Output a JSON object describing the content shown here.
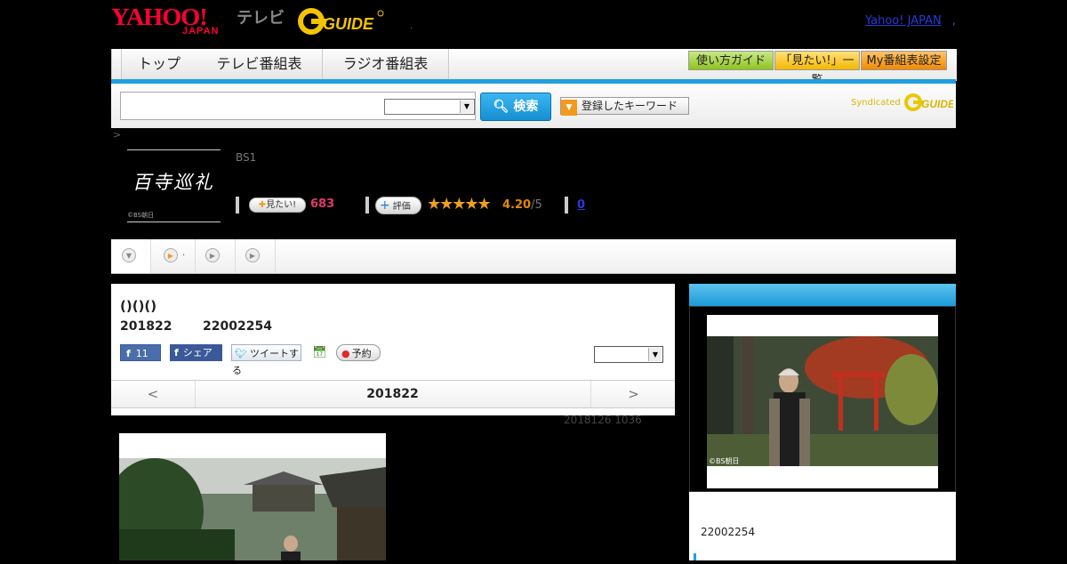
{
  "header": {
    "yahoo_logo": "YAHOO!",
    "yahoo_logo_sub": "JAPAN",
    "tv_label": "テレビ",
    "gguide_logo": "GUIDE",
    "yahoo_japan_link": "Yahoo! JAPAN",
    "dot": ".",
    "dot2": ","
  },
  "nav": {
    "tabs": [
      {
        "label": "トップ"
      },
      {
        "label": "テレビ番組表"
      },
      {
        "label": "ラジオ番組表"
      }
    ],
    "right_buttons": [
      {
        "label": "使い方ガイド",
        "color": "#8fc31f"
      },
      {
        "label": "「見たい!」一覧",
        "color": "#f5b800"
      },
      {
        "label": "My番組表設定",
        "color": "#f08a00"
      }
    ]
  },
  "search": {
    "input_value": "",
    "search_button": "検索",
    "keyword_button": "登録したキーワード",
    "syndicated": "Syndicated"
  },
  "crumb": ">",
  "program": {
    "thumb_title": "百寺巡礼",
    "thumb_copyright": "©BS朝日",
    "channel": "BS1",
    "mitai_label": "見たい!",
    "mitai_count": "683",
    "rate_label": "評価",
    "stars": "★★★★★",
    "score": "4.20",
    "score_max": "/5",
    "review_count": "0"
  },
  "tabs": {
    "dot_label": "."
  },
  "detail": {
    "title": "()()()",
    "date": "201822",
    "time": "22002254",
    "fb_like_count": "11",
    "fb_share": "シェア",
    "tweet": "ツイートする",
    "reserve": "予約",
    "prev": "<",
    "current_date": "201822",
    "next": ">",
    "updated": "2018126  1036"
  },
  "rpanel": {
    "copyright": "©BS朝日",
    "time_code": "22002254"
  },
  "colors": {
    "accent_blue": "#1f9fdf",
    "mitai_pink": "#e03a6a",
    "star_orange": "#f0a01e",
    "yahoo_red": "#ff0033"
  }
}
